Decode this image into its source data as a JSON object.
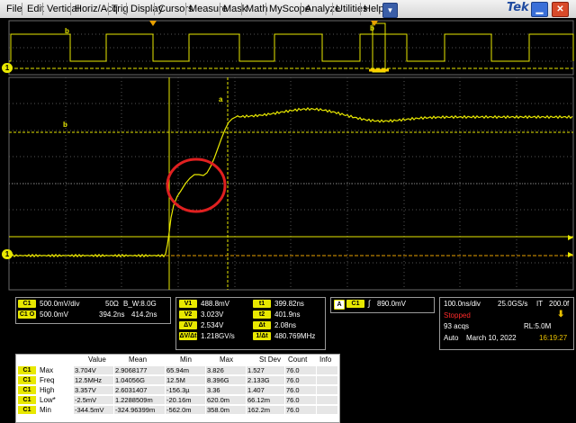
{
  "menu": {
    "items": [
      "File",
      "Edit",
      "Vertical",
      "Horiz/Acq",
      "Trig",
      "Display",
      "Cursors",
      "Measure",
      "Mask",
      "Math",
      "MyScope",
      "Analyze",
      "Utilities",
      "Help"
    ],
    "brand": "Tek",
    "dropdown_icon": "chevron-down-icon",
    "minimize_icon": "minimize-icon",
    "close_icon": "close-icon"
  },
  "colors": {
    "trace": "#e8e800",
    "cursor": "#e8e800",
    "grid": "#555555",
    "highlight": "#e02020"
  },
  "overview": {
    "channel_marker": "1",
    "cursor_tag": "b"
  },
  "main": {
    "channel_marker": "1",
    "cursor_tag_a": "a",
    "cursor_tag_b": "b"
  },
  "channel_panel": {
    "ch1_tag": "C1",
    "ch1_scale": "500.0mV/div",
    "ch1_impedance": "50Ω",
    "ch1_bw": "B_W:8.0G",
    "ch1_offset_tag": "C1 O",
    "ch1_offset": "500.0mV",
    "ch1_pos1": "394.2ns",
    "ch1_pos2": "414.2ns"
  },
  "cursor_panel": {
    "v1_label": "V1",
    "v1_value": "488.8mV",
    "v2_label": "V2",
    "v2_value": "3.023V",
    "dv_label": "ΔV",
    "dv_value": "2.534V",
    "dvdt_label": "ΔV/Δt",
    "dvdt_value": "1.218GV/s",
    "t1_label": "t1",
    "t1_value": "399.82ns",
    "t2_label": "t2",
    "t2_value": "401.9ns",
    "dt_label": "Δt",
    "dt_value": "2.08ns",
    "inv_label": "1/Δt",
    "inv_value": "480.769MHz"
  },
  "trigger_panel": {
    "mode_tag": "A",
    "channel_tag": "C1",
    "slope": "∫",
    "level": "890.0mV"
  },
  "acq_panel": {
    "timebase": "100.0ns/div",
    "sample_rate": "25.0GS/s",
    "mode": "IT",
    "time_per_pt": "200.0f",
    "state": "Stopped",
    "acqs": "93 acqs",
    "record_length": "RL:5.0M",
    "trigger_mode": "Auto",
    "date": "March 10, 2022",
    "time": "16:19:27"
  },
  "measurements": {
    "headers": [
      "Value",
      "Mean",
      "Min",
      "Max",
      "St Dev",
      "Count",
      "Info"
    ],
    "rows": [
      {
        "tag": "C1",
        "name": "Max",
        "cells": [
          "3.704V",
          "2.9068177",
          "65.94m",
          "3.826",
          "1.527",
          "76.0",
          ""
        ]
      },
      {
        "tag": "C1",
        "name": "Freq",
        "cells": [
          "12.5MHz",
          "1.04056G",
          "12.5M",
          "8.396G",
          "2.133G",
          "76.0",
          ""
        ]
      },
      {
        "tag": "C1",
        "name": "High",
        "cells": [
          "3.357V",
          "2.6031407",
          "-156.3µ",
          "3.36",
          "1.407",
          "76.0",
          ""
        ]
      },
      {
        "tag": "C1",
        "name": "Low*",
        "cells": [
          "-2.5mV",
          "1.2288509m",
          "-20.16m",
          "620.0m",
          "66.12m",
          "76.0",
          ""
        ]
      },
      {
        "tag": "C1",
        "name": "Min",
        "cells": [
          "-344.5mV",
          "-324.96399m",
          "-562.0m",
          "358.0m",
          "162.2m",
          "76.0",
          ""
        ]
      }
    ]
  }
}
